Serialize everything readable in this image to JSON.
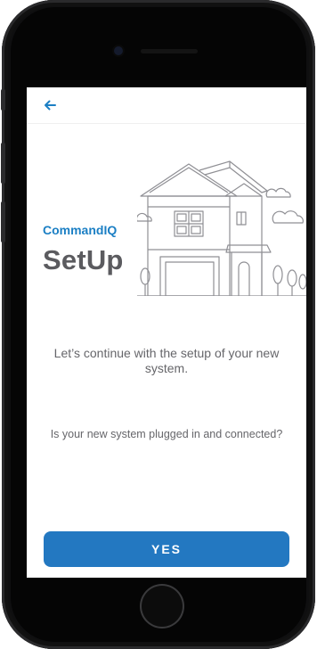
{
  "header": {
    "back_icon": "arrow-left-icon"
  },
  "brand": {
    "name": "CommandIQ"
  },
  "title": "SetUp",
  "illustration": {
    "icon": "house-illustration"
  },
  "messages": {
    "continue_setup": "Let’s continue with the setup of your new system.",
    "plugged_question": "Is your new system plugged in and connected?"
  },
  "actions": {
    "yes_label": "YES"
  },
  "colors": {
    "accent": "#2378c1",
    "brand": "#1b7fc4",
    "text": "#66666a",
    "title": "#5b5b5f"
  }
}
